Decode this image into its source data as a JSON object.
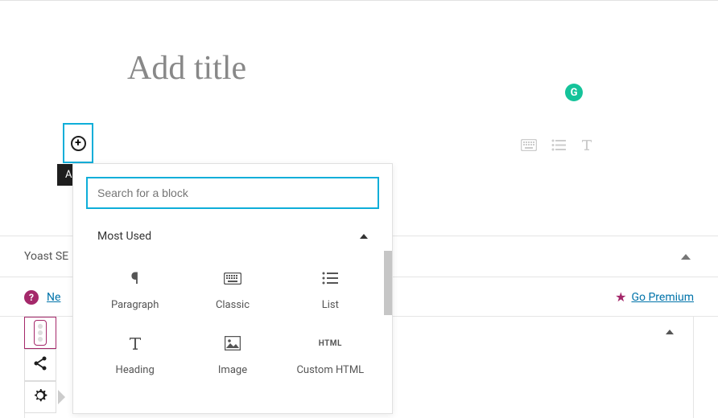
{
  "editor": {
    "title_placeholder": "Add title",
    "add_block_tooltip": "Add block",
    "search_placeholder": "Search for a block"
  },
  "block_panel": {
    "section_label": "Most Used",
    "blocks": [
      {
        "icon": "paragraph",
        "label": "Paragraph"
      },
      {
        "icon": "keyboard",
        "label": "Classic"
      },
      {
        "icon": "list",
        "label": "List"
      },
      {
        "icon": "heading",
        "label": "Heading"
      },
      {
        "icon": "image",
        "label": "Image"
      },
      {
        "icon": "html",
        "label": "Custom HTML"
      }
    ]
  },
  "yoast": {
    "title": "Yoast SE",
    "need_help_partial": "Ne",
    "go_premium": "Go Premium"
  }
}
